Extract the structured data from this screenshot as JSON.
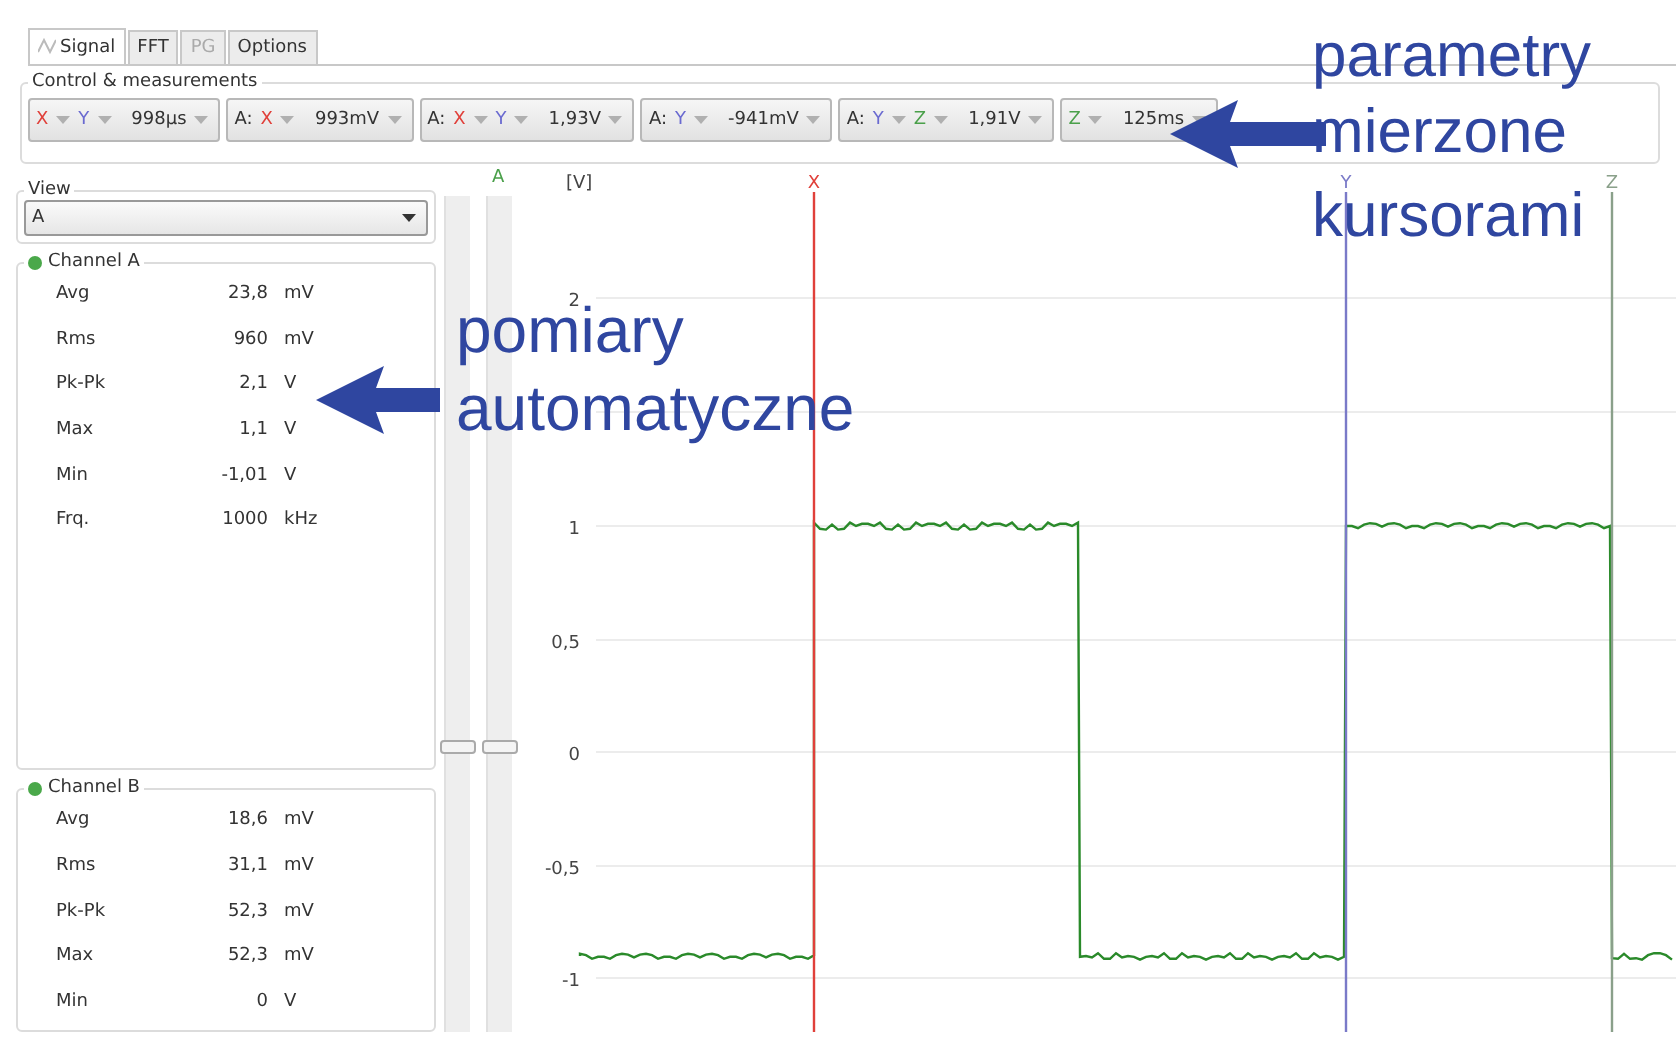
{
  "tabs": [
    {
      "label": "Signal",
      "selected": true,
      "disabled": false
    },
    {
      "label": "FFT",
      "selected": false,
      "disabled": false
    },
    {
      "label": "PG",
      "selected": false,
      "disabled": true
    },
    {
      "label": "Options",
      "selected": false,
      "disabled": false
    }
  ],
  "measurements": {
    "title": "Control & measurements",
    "items": [
      {
        "cursors": [
          {
            "letter": "X",
            "color": "#e0403a"
          },
          {
            "letter": "Y",
            "color": "#6a6ad0"
          }
        ],
        "value": "998µs"
      },
      {
        "channel": "A:",
        "cursors": [
          {
            "letter": "X",
            "color": "#e0403a"
          }
        ],
        "value": "993mV"
      },
      {
        "channel": "A:",
        "cursors": [
          {
            "letter": "X",
            "color": "#e0403a"
          },
          {
            "letter": "Y",
            "color": "#6a6ad0"
          }
        ],
        "value": "1,93V"
      },
      {
        "channel": "A:",
        "cursors": [
          {
            "letter": "Y",
            "color": "#6a6ad0"
          }
        ],
        "value": "-941mV"
      },
      {
        "channel": "A:",
        "cursors": [
          {
            "letter": "Y",
            "color": "#6a6ad0"
          },
          {
            "letter": "Z",
            "color": "#4aa04a"
          }
        ],
        "value": "1,91V"
      },
      {
        "cursors": [
          {
            "letter": "Z",
            "color": "#4aa04a"
          }
        ],
        "value": "125ms"
      }
    ]
  },
  "view": {
    "label": "View",
    "value": "A"
  },
  "channels": [
    {
      "name": "Channel A",
      "rows": [
        {
          "label": "Avg",
          "value": "23,8",
          "unit": "mV"
        },
        {
          "label": "Rms",
          "value": "960",
          "unit": "mV"
        },
        {
          "label": "Pk-Pk",
          "value": "2,1",
          "unit": "V"
        },
        {
          "label": "Max",
          "value": "1,1",
          "unit": "V"
        },
        {
          "label": "Min",
          "value": "-1,01",
          "unit": "V"
        },
        {
          "label": "Frq.",
          "value": "1000",
          "unit": "kHz"
        }
      ]
    },
    {
      "name": "Channel B",
      "rows": [
        {
          "label": "Avg",
          "value": "18,6",
          "unit": "mV"
        },
        {
          "label": "Rms",
          "value": "31,1",
          "unit": "mV"
        },
        {
          "label": "Pk-Pk",
          "value": "52,3",
          "unit": "mV"
        },
        {
          "label": "Max",
          "value": "52,3",
          "unit": "mV"
        },
        {
          "label": "Min",
          "value": "0",
          "unit": "V"
        }
      ]
    }
  ],
  "sliders": [
    {
      "level": 0.34
    },
    {
      "level": 0.34
    }
  ],
  "plot": {
    "channel": "A",
    "unit": "[V]",
    "y_labels": [
      "2",
      "1",
      "0,5",
      "0",
      "-0,5",
      "-1"
    ],
    "cursors": [
      {
        "label": "X",
        "color": "#e0403a"
      },
      {
        "label": "Y",
        "color": "#7a7ac8"
      },
      {
        "label": "Z",
        "color": "#8aa08a"
      }
    ]
  },
  "annotations": [
    {
      "lines": [
        "parametry",
        "mierzone",
        "kursorami"
      ]
    },
    {
      "lines": [
        "pomiary",
        "automatyczne"
      ]
    }
  ]
}
